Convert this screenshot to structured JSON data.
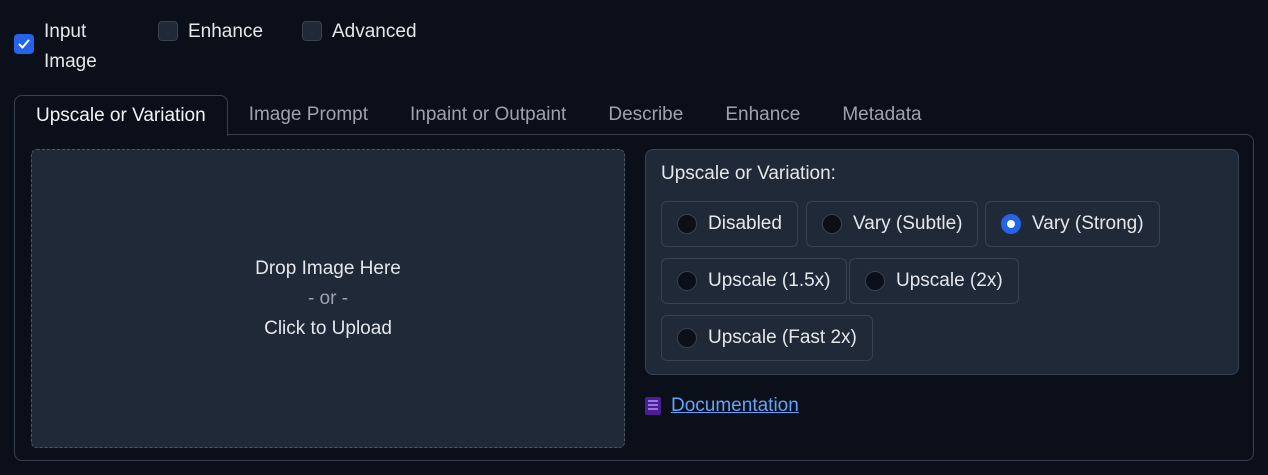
{
  "checkboxes": [
    {
      "label": "Input Image",
      "checked": true
    },
    {
      "label": "Enhance",
      "checked": false
    },
    {
      "label": "Advanced",
      "checked": false
    }
  ],
  "tabs": [
    {
      "label": "Upscale or Variation",
      "active": true
    },
    {
      "label": "Image Prompt",
      "active": false
    },
    {
      "label": "Inpaint or Outpaint",
      "active": false
    },
    {
      "label": "Describe",
      "active": false
    },
    {
      "label": "Enhance",
      "active": false
    },
    {
      "label": "Metadata",
      "active": false
    }
  ],
  "upload": {
    "line1": "Drop Image Here",
    "line2": "- or -",
    "line3": "Click to Upload"
  },
  "upscale": {
    "title": "Upscale or Variation:",
    "options": [
      {
        "label": "Disabled",
        "selected": false
      },
      {
        "label": "Vary (Subtle)",
        "selected": false
      },
      {
        "label": "Vary (Strong)",
        "selected": true
      },
      {
        "label": "Upscale (1.5x)",
        "selected": false
      },
      {
        "label": "Upscale (2x)",
        "selected": false
      },
      {
        "label": "Upscale (Fast 2x)",
        "selected": false
      }
    ]
  },
  "documentation": {
    "icon": "building-icon",
    "label": "Documentation"
  },
  "colors": {
    "background": "#0b0f19",
    "accent": "#2563eb",
    "link": "#60a5fa"
  }
}
